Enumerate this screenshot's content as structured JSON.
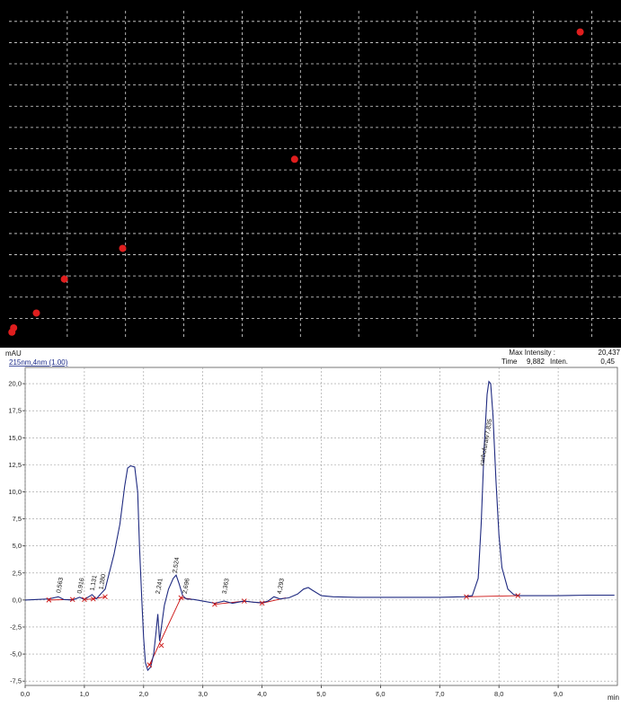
{
  "chart_data": [
    {
      "type": "scatter",
      "title": "",
      "ylabel": "",
      "xlabel": "",
      "grid": true,
      "colors": {
        "background": "#000000",
        "grid": "#dddddd",
        "point": "#e01e1e"
      },
      "x_ticks": [
        "",
        "",
        "",
        "",
        "",
        "",
        "",
        "",
        "",
        ""
      ],
      "y_ticks": [
        "",
        "",
        "",
        "",
        "",
        "",
        "",
        "",
        "",
        "",
        "",
        "",
        "",
        "",
        ""
      ],
      "points": [
        {
          "x": 0.05,
          "y": 0.35
        },
        {
          "x": 0.08,
          "y": 0.55
        },
        {
          "x": 0.47,
          "y": 1.25
        },
        {
          "x": 0.95,
          "y": 2.85
        },
        {
          "x": 1.95,
          "y": 4.3
        },
        {
          "x": 4.9,
          "y": 8.5
        },
        {
          "x": 9.8,
          "y": 14.5
        }
      ],
      "xlim": [
        0,
        10.5
      ],
      "ylim": [
        0,
        15.5
      ]
    },
    {
      "type": "line",
      "ylabel": "mAU",
      "xlabel": "min",
      "channel_label": "215nm,4nm (1.00)",
      "header": {
        "max_intensity_label": "Max Intensity :",
        "max_intensity_value": "20,437",
        "time_label": "Time",
        "time_value": "9,882",
        "inten_label": "Inten.",
        "inten_value": "0,45"
      },
      "colors": {
        "trace": "#1f2a80",
        "baseline": "#cc1111",
        "grid": "#9a9a9a"
      },
      "x_ticks": [
        "0,0",
        "1,0",
        "2,0",
        "3,0",
        "4,0",
        "5,0",
        "6,0",
        "7,0",
        "8,0",
        "9,0"
      ],
      "y_ticks": [
        "20,0",
        "17,5",
        "15,0",
        "12,5",
        "10,0",
        "7,5",
        "5,0",
        "2,5",
        "0,0",
        "-2,5",
        "-5,0",
        "-7,5"
      ],
      "xlim": [
        0,
        10.0
      ],
      "ylim": [
        -7.9,
        21.5
      ],
      "peak_labels": [
        {
          "x": 0.563,
          "text": "0,563"
        },
        {
          "x": 0.916,
          "text": "0,916"
        },
        {
          "x": 1.131,
          "text": "1,131"
        },
        {
          "x": 1.28,
          "text": "1,280"
        },
        {
          "x": 2.241,
          "text": "2,241"
        },
        {
          "x": 2.524,
          "text": "2,524"
        },
        {
          "x": 2.696,
          "text": "2,696"
        },
        {
          "x": 3.363,
          "text": "3,363"
        },
        {
          "x": 4.293,
          "text": "4,293"
        },
        {
          "x": 7.835,
          "text": "carbofuran/7,835"
        }
      ],
      "series": [
        {
          "points": [
            [
              0.0,
              0.0
            ],
            [
              0.2,
              0.05
            ],
            [
              0.4,
              0.1
            ],
            [
              0.56,
              0.3
            ],
            [
              0.65,
              0.05
            ],
            [
              0.8,
              0.0
            ],
            [
              0.92,
              0.25
            ],
            [
              1.0,
              0.05
            ],
            [
              1.13,
              0.5
            ],
            [
              1.2,
              0.1
            ],
            [
              1.28,
              0.6
            ],
            [
              1.35,
              1.0
            ],
            [
              1.42,
              2.5
            ],
            [
              1.5,
              4.2
            ],
            [
              1.6,
              7.0
            ],
            [
              1.68,
              10.5
            ],
            [
              1.73,
              12.2
            ],
            [
              1.78,
              12.4
            ],
            [
              1.85,
              12.3
            ],
            [
              1.9,
              10.0
            ],
            [
              1.93,
              5.0
            ],
            [
              1.97,
              0.0
            ],
            [
              2.0,
              -3.5
            ],
            [
              2.03,
              -5.8
            ],
            [
              2.07,
              -6.5
            ],
            [
              2.12,
              -6.2
            ],
            [
              2.17,
              -5.0
            ],
            [
              2.21,
              -3.0
            ],
            [
              2.24,
              -1.3
            ],
            [
              2.27,
              -3.8
            ],
            [
              2.3,
              -2.5
            ],
            [
              2.35,
              -0.5
            ],
            [
              2.42,
              1.0
            ],
            [
              2.5,
              2.0
            ],
            [
              2.55,
              2.3
            ],
            [
              2.6,
              1.5
            ],
            [
              2.66,
              0.4
            ],
            [
              2.72,
              0.1
            ],
            [
              2.85,
              0.05
            ],
            [
              3.0,
              -0.1
            ],
            [
              3.2,
              -0.3
            ],
            [
              3.36,
              -0.1
            ],
            [
              3.5,
              -0.3
            ],
            [
              3.7,
              -0.1
            ],
            [
              3.85,
              -0.2
            ],
            [
              4.0,
              -0.25
            ],
            [
              4.1,
              -0.1
            ],
            [
              4.2,
              0.3
            ],
            [
              4.3,
              0.1
            ],
            [
              4.45,
              0.2
            ],
            [
              4.6,
              0.55
            ],
            [
              4.7,
              1.0
            ],
            [
              4.78,
              1.15
            ],
            [
              4.85,
              0.9
            ],
            [
              5.0,
              0.4
            ],
            [
              5.2,
              0.3
            ],
            [
              5.6,
              0.25
            ],
            [
              6.0,
              0.25
            ],
            [
              6.5,
              0.25
            ],
            [
              7.0,
              0.25
            ],
            [
              7.4,
              0.3
            ],
            [
              7.55,
              0.4
            ],
            [
              7.65,
              2.0
            ],
            [
              7.7,
              7.0
            ],
            [
              7.75,
              14.0
            ],
            [
              7.8,
              19.0
            ],
            [
              7.83,
              20.2
            ],
            [
              7.86,
              20.0
            ],
            [
              7.9,
              17.0
            ],
            [
              7.95,
              11.0
            ],
            [
              8.0,
              6.0
            ],
            [
              8.05,
              3.0
            ],
            [
              8.15,
              1.0
            ],
            [
              8.25,
              0.5
            ],
            [
              8.35,
              0.4
            ],
            [
              8.6,
              0.4
            ],
            [
              9.0,
              0.4
            ],
            [
              9.5,
              0.45
            ],
            [
              9.95,
              0.45
            ]
          ]
        }
      ],
      "baseline_segments": [
        [
          [
            0.4,
            0.0
          ],
          [
            0.8,
            0.05
          ]
        ],
        [
          [
            1.0,
            0.05
          ],
          [
            1.15,
            0.1
          ]
        ],
        [
          [
            1.15,
            0.1
          ],
          [
            1.35,
            0.3
          ]
        ],
        [
          [
            2.1,
            -6.0
          ],
          [
            2.63,
            0.2
          ]
        ],
        [
          [
            2.63,
            0.2
          ],
          [
            2.8,
            0.1
          ]
        ],
        [
          [
            3.2,
            -0.4
          ],
          [
            3.7,
            -0.1
          ]
        ],
        [
          [
            3.7,
            -0.1
          ],
          [
            4.0,
            -0.3
          ]
        ],
        [
          [
            4.0,
            -0.3
          ],
          [
            4.4,
            0.2
          ]
        ],
        [
          [
            7.45,
            0.3
          ],
          [
            8.32,
            0.4
          ]
        ]
      ],
      "markers": [
        [
          0.4,
          0.0
        ],
        [
          0.8,
          0.05
        ],
        [
          1.0,
          0.05
        ],
        [
          1.15,
          0.1
        ],
        [
          1.35,
          0.3
        ],
        [
          2.1,
          -6.0
        ],
        [
          2.3,
          -4.2
        ],
        [
          2.63,
          0.2
        ],
        [
          3.2,
          -0.4
        ],
        [
          3.7,
          -0.1
        ],
        [
          4.0,
          -0.3
        ],
        [
          7.45,
          0.3
        ],
        [
          8.32,
          0.4
        ]
      ]
    }
  ]
}
